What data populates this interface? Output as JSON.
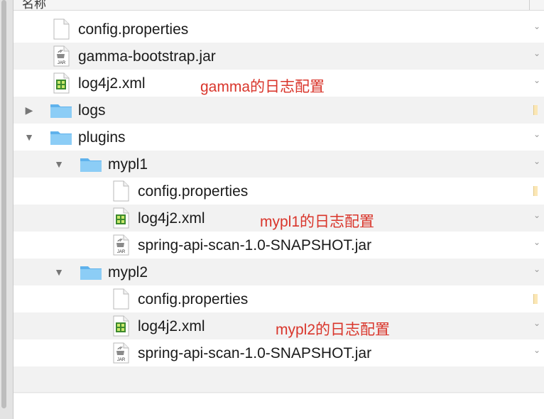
{
  "header": {
    "name_label": "名称"
  },
  "rows": [
    {
      "label": "config.properties"
    },
    {
      "label": "gamma-bootstrap.jar"
    },
    {
      "label": "log4j2.xml",
      "note": "gamma的日志配置"
    },
    {
      "label": "logs"
    },
    {
      "label": "plugins"
    },
    {
      "label": "mypl1"
    },
    {
      "label": "config.properties"
    },
    {
      "label": "log4j2.xml",
      "note": "mypl1的日志配置"
    },
    {
      "label": "spring-api-scan-1.0-SNAPSHOT.jar"
    },
    {
      "label": "mypl2"
    },
    {
      "label": "config.properties"
    },
    {
      "label": "log4j2.xml",
      "note": "mypl2的日志配置"
    },
    {
      "label": "spring-api-scan-1.0-SNAPSHOT.jar"
    }
  ],
  "icons": {
    "jar_badge": "JAR"
  },
  "colors": {
    "annotation": "#d9352b",
    "folder": "#71bff2",
    "row_alt": "#f2f2f2"
  }
}
